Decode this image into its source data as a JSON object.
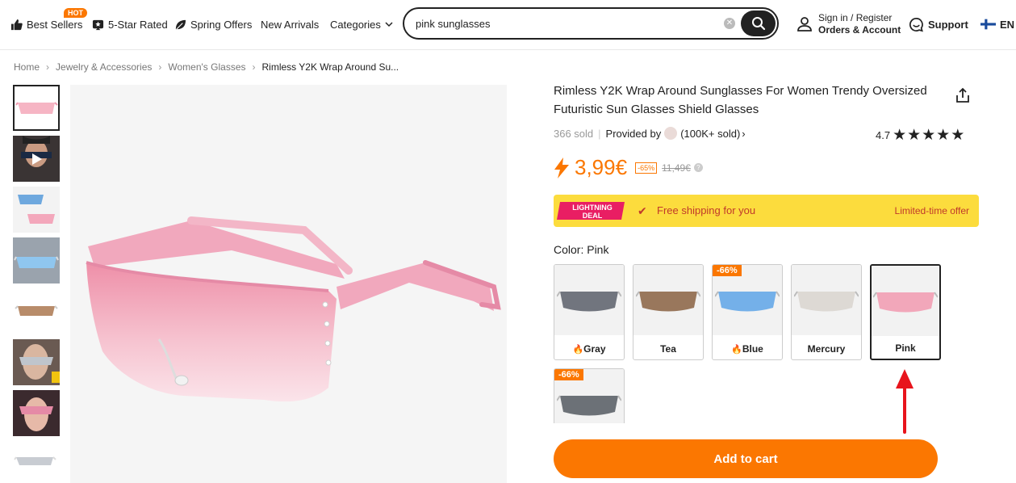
{
  "nav": {
    "best_sellers": "Best Sellers",
    "hot_badge": "HOT",
    "five_star": "5-Star Rated",
    "spring_offers": "Spring Offers",
    "new_arrivals": "New Arrivals",
    "categories": "Categories",
    "search_value": "pink sunglasses",
    "sign_in": "Sign in / Register",
    "orders_account": "Orders & Account",
    "support": "Support",
    "language": "EN"
  },
  "breadcrumb": {
    "home": "Home",
    "category": "Jewelry & Accessories",
    "subcategory": "Women's Glasses",
    "current": "Rimless Y2K Wrap Around Su..."
  },
  "product": {
    "title": "Rimless Y2K Wrap Around Sunglasses For Women Trendy Oversized Futuristic Sun Glasses Shield Glasses",
    "sold": "366 sold",
    "provided_by": "Provided by",
    "seller_sold": "(100K+ sold)",
    "rating": "4.7",
    "stars": "★★★★★",
    "price": "3,99€",
    "discount": "-65%",
    "old_price": "11,49€",
    "deal_logo_line1": "LIGHTNING",
    "deal_logo_line2": "DEAL",
    "free_shipping": "Free shipping for you",
    "limited_offer": "Limited-time offer",
    "color_label": "Color: Pink",
    "add_to_cart": "Add to cart"
  },
  "variants": [
    {
      "name": "Gray",
      "hot": true,
      "discount": "",
      "lens": "#5a5f6a"
    },
    {
      "name": "Tea",
      "hot": false,
      "discount": "",
      "lens": "#8a6242"
    },
    {
      "name": "Blue",
      "hot": true,
      "discount": "-66%",
      "lens": "#5ea5e8"
    },
    {
      "name": "Mercury",
      "hot": false,
      "discount": "",
      "lens": "#d9d5cf"
    },
    {
      "name": "Pink",
      "hot": false,
      "discount": "",
      "lens": "#f29ab0"
    },
    {
      "name": "",
      "hot": false,
      "discount": "-66%",
      "lens": "#555b62"
    }
  ],
  "colors": {
    "accent": "#fb7701",
    "deal_bg": "#fcdc3d",
    "deal_text": "#c0392b",
    "annotation_arrow": "#e8141c"
  }
}
